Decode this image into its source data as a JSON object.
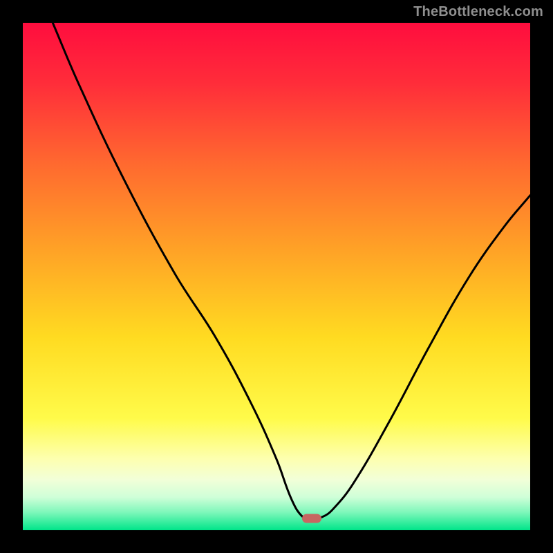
{
  "watermark": {
    "text": "TheBottleneck.com"
  },
  "colors": {
    "background": "#000000",
    "gradient_stops": [
      {
        "offset": 0.0,
        "color": "#ff0d3e"
      },
      {
        "offset": 0.12,
        "color": "#ff2d3a"
      },
      {
        "offset": 0.28,
        "color": "#ff6a2f"
      },
      {
        "offset": 0.45,
        "color": "#ffa326"
      },
      {
        "offset": 0.62,
        "color": "#ffdb21"
      },
      {
        "offset": 0.78,
        "color": "#fffb4a"
      },
      {
        "offset": 0.86,
        "color": "#fdffb0"
      },
      {
        "offset": 0.9,
        "color": "#f2ffd8"
      },
      {
        "offset": 0.935,
        "color": "#cfffd8"
      },
      {
        "offset": 0.965,
        "color": "#7df7ba"
      },
      {
        "offset": 1.0,
        "color": "#00e589"
      }
    ],
    "curve": "#000000",
    "marker_fill": "#c76761",
    "watermark": "#8f8f8f"
  },
  "marker": {
    "x_pct": 0.57,
    "y_pct": 0.977
  },
  "chart_data": {
    "type": "line",
    "title": "",
    "xlabel": "",
    "ylabel": "",
    "x_range_pct": [
      0,
      100
    ],
    "y_range_pct": [
      0,
      100
    ],
    "note": "Axes are unlabeled in the source image; x and y are expressed as percentages of plot width/height (y=0 bottom, y=100 top).",
    "series": [
      {
        "name": "bottleneck-curve",
        "points": [
          {
            "x": 5.9,
            "y": 100.0
          },
          {
            "x": 11.0,
            "y": 88.0
          },
          {
            "x": 20.0,
            "y": 69.0
          },
          {
            "x": 30.0,
            "y": 50.5
          },
          {
            "x": 38.0,
            "y": 38.0
          },
          {
            "x": 45.0,
            "y": 25.0
          },
          {
            "x": 50.0,
            "y": 14.0
          },
          {
            "x": 53.0,
            "y": 6.0
          },
          {
            "x": 55.2,
            "y": 2.6
          },
          {
            "x": 57.0,
            "y": 2.3
          },
          {
            "x": 59.0,
            "y": 2.6
          },
          {
            "x": 61.0,
            "y": 4.0
          },
          {
            "x": 65.0,
            "y": 9.0
          },
          {
            "x": 72.0,
            "y": 21.0
          },
          {
            "x": 80.0,
            "y": 36.0
          },
          {
            "x": 88.0,
            "y": 50.0
          },
          {
            "x": 95.0,
            "y": 60.0
          },
          {
            "x": 100.0,
            "y": 66.0
          }
        ]
      }
    ],
    "marker": {
      "x": 57.0,
      "y": 2.3
    }
  }
}
